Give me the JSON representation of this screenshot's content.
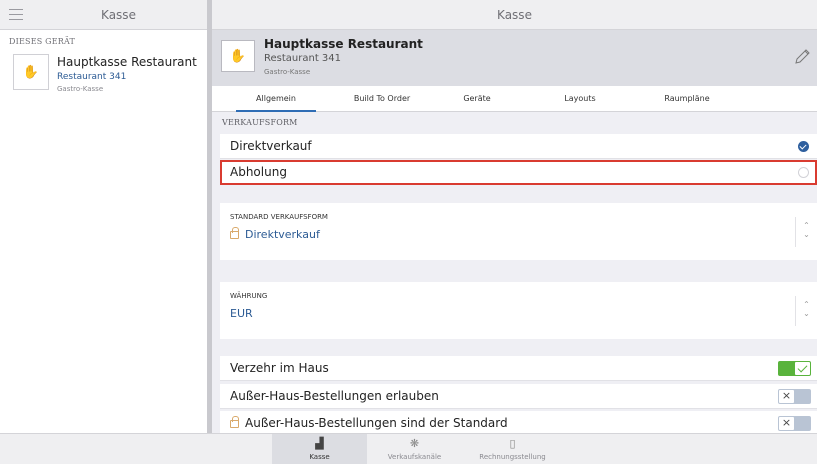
{
  "sidebar": {
    "title": "Kasse",
    "section_label": "DIESES GERÄT",
    "device": {
      "name": "Hauptkasse Restaurant",
      "location": "Restaurant 341",
      "type": "Gastro-Kasse",
      "icon": "hand-icon"
    }
  },
  "main": {
    "title": "Kasse",
    "device_card": {
      "name": "Hauptkasse Restaurant",
      "location": "Restaurant 341",
      "type": "Gastro-Kasse",
      "icon": "hand-icon"
    },
    "tabs": [
      {
        "label": "Allgemein",
        "active": true
      },
      {
        "label": "Build To Order",
        "active": false
      },
      {
        "label": "Geräte",
        "active": false
      },
      {
        "label": "Layouts",
        "active": false
      },
      {
        "label": "Raumpläne",
        "active": false
      }
    ],
    "verkaufsform": {
      "label": "VERKAUFSFORM",
      "options": [
        {
          "label": "Direktverkauf",
          "selected": true
        },
        {
          "label": "Abholung",
          "selected": false
        }
      ]
    },
    "standard_verkaufsform": {
      "caption": "STANDARD VERKAUFSFORM",
      "value": "Direktverkauf",
      "locked": true
    },
    "waehrung": {
      "caption": "WÄHRUNG",
      "value": "EUR"
    },
    "settings": [
      {
        "label": "Verzehr im Haus",
        "enabled": true
      },
      {
        "label": "Außer-Haus-Bestellungen erlauben",
        "enabled": false
      },
      {
        "label": "Außer-Haus-Bestellungen sind der Standard",
        "enabled": false,
        "locked": true
      }
    ]
  },
  "bottom_nav": [
    {
      "label": "Kasse",
      "icon": "register-icon",
      "active": true
    },
    {
      "label": "Verkaufskanäle",
      "icon": "channels-icon",
      "active": false
    },
    {
      "label": "Rechnungsstellung",
      "icon": "invoice-icon",
      "active": false
    }
  ],
  "colors": {
    "accent": "#2f6db5",
    "link_text": "#2c5b94",
    "toggle_on": "#59b33c",
    "toggle_off": "#b9c4d4",
    "highlight_border": "#d93b30",
    "lock": "#d9a96b"
  }
}
